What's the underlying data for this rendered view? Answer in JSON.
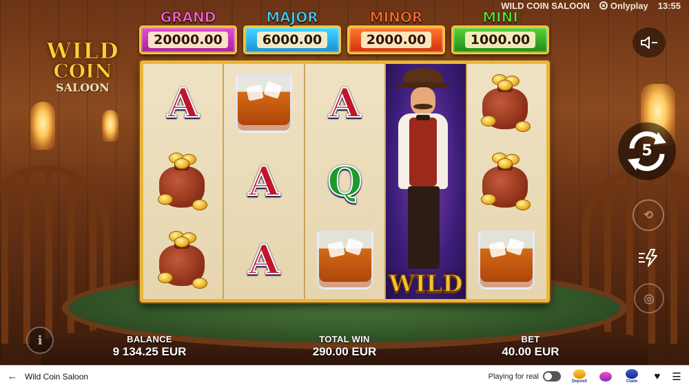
{
  "game": {
    "logo": {
      "line1": "WILD",
      "line2": "COIN",
      "line3": "SALOON"
    },
    "title": "WILD COIN SALOON",
    "provider": "Onlyplay",
    "clock": "13:55"
  },
  "jackpots": [
    {
      "name": "GRAND",
      "value": "20000.00",
      "color": "#d63fc8"
    },
    {
      "name": "MAJOR",
      "value": "6000.00",
      "color": "#2aa8e8"
    },
    {
      "name": "MINOR",
      "value": "2000.00",
      "color": "#e84a1c"
    },
    {
      "name": "MINI",
      "value": "1000.00",
      "color": "#3cb82a"
    }
  ],
  "reels": [
    [
      "A",
      "coin-bag",
      "coin-bag"
    ],
    [
      "whiskey-glass",
      "A",
      "A"
    ],
    [
      "A",
      "Q",
      "whiskey-glass"
    ],
    [
      "wild-cowboy",
      "wild-cowboy",
      "wild-cowboy"
    ],
    [
      "coin-bag",
      "coin-bag",
      "whiskey-glass"
    ]
  ],
  "wild_label": "WILD",
  "symbols": {
    "ace": "A",
    "queen": "Q"
  },
  "controls": {
    "sound_icon": "sound-off-icon",
    "spin_icon": "spin-arrows-icon",
    "spins_remaining": "5",
    "autoplay_icon": "autoplay-icon",
    "turbo_icon": "turbo-icon",
    "stake_icon": "coin-stack-icon",
    "info_label": "i"
  },
  "stats": {
    "balance_label": "BALANCE",
    "balance_value": "9 134.25 EUR",
    "total_win_label": "TOTAL WIN",
    "total_win_value": "290.00 EUR",
    "bet_label": "BET",
    "bet_value": "40.00 EUR"
  },
  "bottom_bar": {
    "back_icon": "←",
    "title": "Wild Coin Saloon",
    "playing_for_real": "Playing for real",
    "promos": [
      {
        "name": "bonus-deposit",
        "text": "Deposit"
      },
      {
        "name": "prize-drops",
        "text": ""
      },
      {
        "name": "jackpotz-claim",
        "text": "Claim"
      }
    ],
    "favorite_icon": "♥",
    "menu_icon": "☰"
  },
  "colors": {
    "accent_gold": "#e9b63a",
    "bottom_bar_bg": "#ffffff"
  }
}
